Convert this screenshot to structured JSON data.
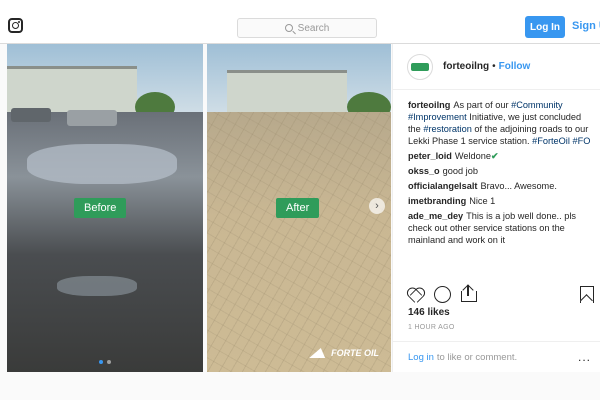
{
  "topbar": {
    "instagram_icon": "instagram-logo",
    "search_placeholder": "Search",
    "login_label": "Log In",
    "signup_label": "Sign Up"
  },
  "photos": {
    "before_label": "Before",
    "after_label": "After",
    "watermark": "FORTE OIL"
  },
  "post": {
    "username": "forteoilng",
    "separator": "•",
    "follow_label": "Follow",
    "caption": {
      "user": "forteoilng",
      "part1": "As part of our ",
      "tag1": "#Community",
      "part2": " ",
      "tag2": "#Improvement",
      "part3": " Initiative, we just concluded the ",
      "tag3": "#restoration",
      "part4": " of the adjoining roads to our Lekki Phase 1 service station. ",
      "tag4": "#ForteOil",
      "part5": " ",
      "tag5": "#FO"
    },
    "comments": [
      {
        "user": "peter_loid",
        "text": "Weldone",
        "emoji": "✔"
      },
      {
        "user": "okss_o",
        "text": "good job"
      },
      {
        "user": "officialangelsalt",
        "text": "Bravo... Awesome."
      },
      {
        "user": "imetbranding",
        "text": "Nice 1"
      },
      {
        "user": "ade_me_dey",
        "text": "This is a job well done.. pls check out other service stations on the mainland and work on it"
      }
    ],
    "likes": "146 likes",
    "time": "1 HOUR AGO",
    "footer": {
      "login_link": "Log in",
      "text": "to like or comment.",
      "more": "..."
    }
  }
}
